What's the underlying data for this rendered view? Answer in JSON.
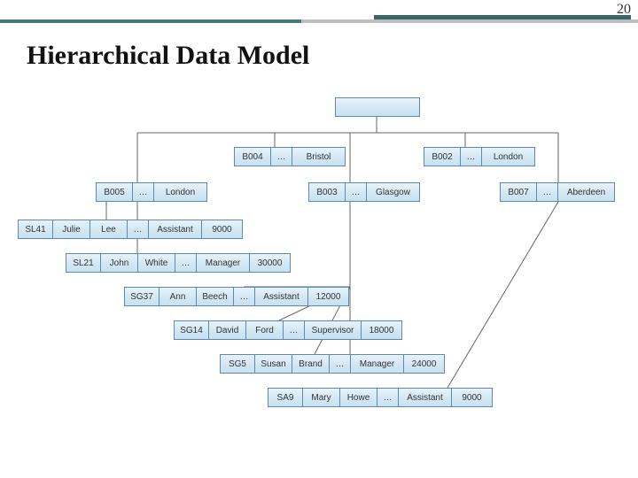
{
  "slide_number": "20",
  "title": "Hierarchical Data Model",
  "root": {
    "label": ""
  },
  "branches_row1": [
    {
      "id": "B004",
      "dots": "…",
      "city": "Bristol"
    },
    {
      "id": "B002",
      "dots": "…",
      "city": "London"
    }
  ],
  "branches_row2": [
    {
      "id": "B005",
      "dots": "…",
      "city": "London"
    },
    {
      "id": "B003",
      "dots": "…",
      "city": "Glasgow"
    },
    {
      "id": "B007",
      "dots": "…",
      "city": "Aberdeen"
    }
  ],
  "staff": [
    {
      "sid": "SL41",
      "fn": "Julie",
      "ln": "Lee",
      "dots": "…",
      "role": "Assistant",
      "salary": "9000"
    },
    {
      "sid": "SL21",
      "fn": "John",
      "ln": "White",
      "dots": "…",
      "role": "Manager",
      "salary": "30000"
    },
    {
      "sid": "SG37",
      "fn": "Ann",
      "ln": "Beech",
      "dots": "…",
      "role": "Assistant",
      "salary": "12000"
    },
    {
      "sid": "SG14",
      "fn": "David",
      "ln": "Ford",
      "dots": "…",
      "role": "Supervisor",
      "salary": "18000"
    },
    {
      "sid": "SG5",
      "fn": "Susan",
      "ln": "Brand",
      "dots": "…",
      "role": "Manager",
      "salary": "24000"
    },
    {
      "sid": "SA9",
      "fn": "Mary",
      "ln": "Howe",
      "dots": "…",
      "role": "Assistant",
      "salary": "9000"
    }
  ]
}
